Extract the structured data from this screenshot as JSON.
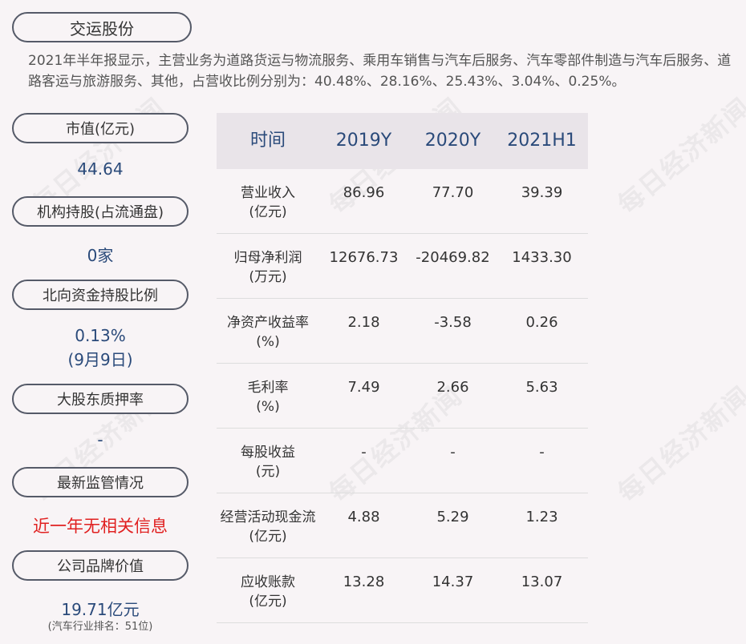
{
  "title": "交运股份",
  "summary": "2021年半年报显示，主营业务为道路货运与物流服务、乘用车销售与汽车后服务、汽车零部件制造与汽车后服务、道路客运与旅游服务、其他，占营收比例分别为：40.48%、28.16%、25.43%、3.04%、0.25%。",
  "sidebar": {
    "market_cap_label": "市值(亿元)",
    "market_cap_value": "44.64",
    "institution_label": "机构持股(占流通盘)",
    "institution_value": "0家",
    "northbound_label": "北向资金持股比例",
    "northbound_value": "0.13%",
    "northbound_date": "(9月9日)",
    "pledge_label": "大股东质押率",
    "pledge_value": "-",
    "regulation_label": "最新监管情况",
    "regulation_value": "近一年无相关信息",
    "brand_label": "公司品牌价值",
    "brand_value": "19.71亿元",
    "brand_note": "(汽车行业排名：51位)"
  },
  "table": {
    "headers": [
      "时间",
      "2019Y",
      "2020Y",
      "2021H1"
    ],
    "rows": [
      {
        "name": "营业收入",
        "unit": "(亿元)",
        "v": [
          "86.96",
          "77.70",
          "39.39"
        ]
      },
      {
        "name": "归母净利润",
        "unit": "(万元)",
        "v": [
          "12676.73",
          "-20469.82",
          "1433.30"
        ]
      },
      {
        "name": "净资产收益率",
        "unit": "(%)",
        "v": [
          "2.18",
          "-3.58",
          "0.26"
        ]
      },
      {
        "name": "毛利率",
        "unit": "(%)",
        "v": [
          "7.49",
          "2.66",
          "5.63"
        ]
      },
      {
        "name": "每股收益",
        "unit": "(元)",
        "v": [
          "-",
          "-",
          "-"
        ]
      },
      {
        "name": "经营活动现金流",
        "unit": "(亿元)",
        "v": [
          "4.88",
          "5.29",
          "1.23"
        ]
      },
      {
        "name": "应收账款",
        "unit": "(亿元)",
        "v": [
          "13.28",
          "14.37",
          "13.07"
        ]
      }
    ]
  },
  "watermark": "每日经济新闻"
}
